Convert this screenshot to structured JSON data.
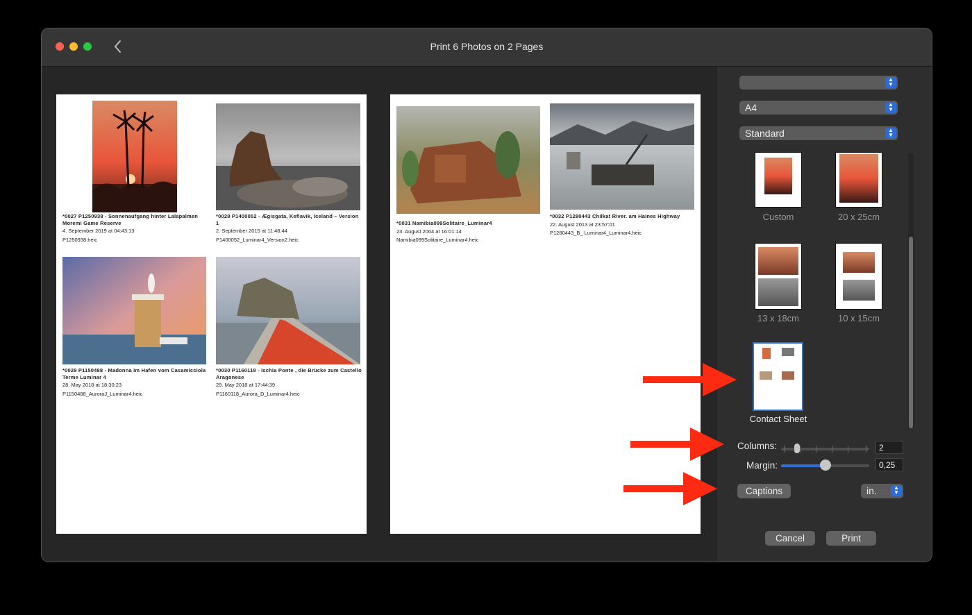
{
  "window": {
    "title": "Print 6 Photos on 2 Pages"
  },
  "pages": [
    {
      "photos": [
        {
          "title": "*0027 P1250938 - Sonnenaufgang hinter Lalapalmen Moremi Game Reserve",
          "date": "4. September 2019 at 04:43:13",
          "file": "P1250938.heic"
        },
        {
          "title": "*0028 P1400052 - Ægisgata, Keflavik, Iceland – Version 1",
          "date": "2. September 2015 at 11:48:44",
          "file": "P1400052_Luminar4_Version2.heic"
        },
        {
          "title": "*0029 P1150488 - Madonna im Hafen vom Casamicciola Terme Luminar 4",
          "date": "28. May 2018 at 18:30:23",
          "file": "P1150488_AuroraJ_Luminar4.heic"
        },
        {
          "title": "*0030 P1160118 - Ischia Ponte , die Brücke zum Castello Aragonese",
          "date": "29. May 2018 at 17:44:39",
          "file": "P1160118_Aurora_D_Luminar4.heic"
        }
      ]
    },
    {
      "photos": [
        {
          "title": "*0031 Namibia099Solitaire_Luminar4",
          "date": "23. August 2004 at 16:01:14",
          "file": "Namibia099Solitaire_Luminar4.heic"
        },
        {
          "title": "*0032 P1280443  Chilkat River. am Haines Highway",
          "date": "22. August 2013 at 23:57:01",
          "file": "P1280443_B_ Luminar4_Luminar4.heic"
        }
      ]
    }
  ],
  "settings": {
    "printer_value": "",
    "paper_size": "A4",
    "quality": "Standard",
    "layouts": [
      {
        "label": "Custom"
      },
      {
        "label": "20 x 25cm"
      },
      {
        "label": "13 x 18cm"
      },
      {
        "label": "10 x 15cm"
      },
      {
        "label": "Contact Sheet",
        "selected": true
      }
    ],
    "columns_label": "Columns:",
    "columns_value": "2",
    "margin_label": "Margin:",
    "margin_value": "0,25",
    "margin_level": 0.5,
    "captions_label": "Captions",
    "units": "in.",
    "cancel_label": "Cancel",
    "print_label": "Print"
  },
  "colors": {
    "accent": "#2f6fd8",
    "annotation_arrow": "#ff2a12"
  },
  "icons": [
    "back-chevron-icon",
    "stepper-icon"
  ]
}
